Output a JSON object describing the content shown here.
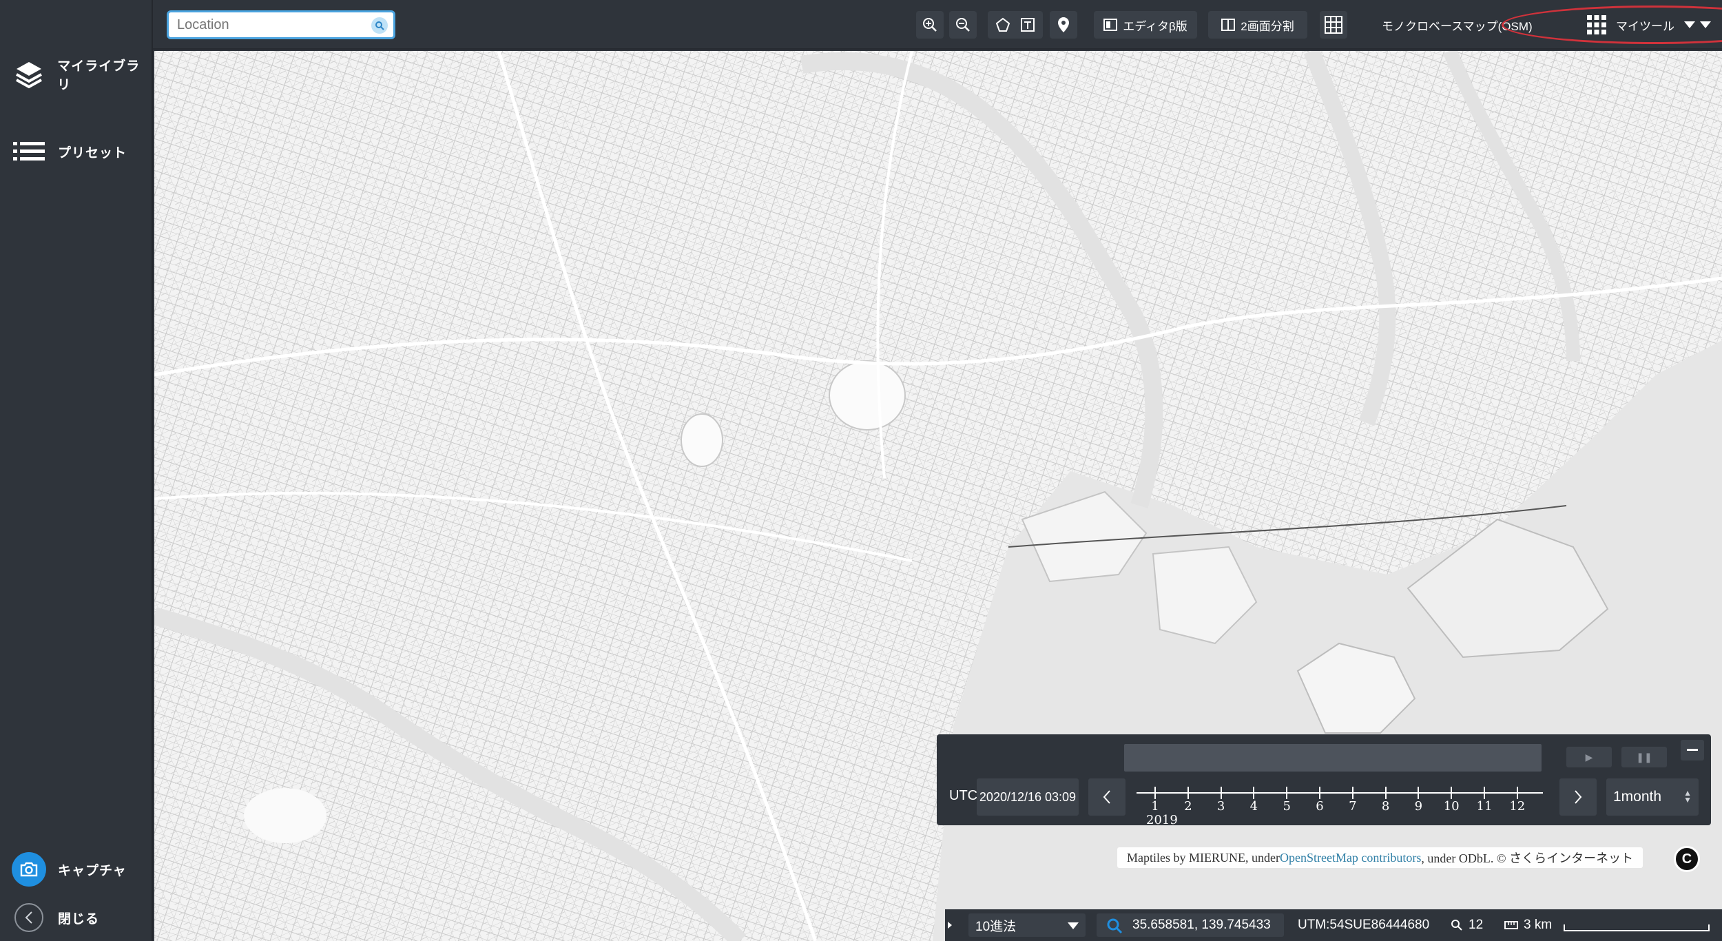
{
  "sidebar": {
    "items": [
      {
        "label": "マイライブラリ",
        "icon": "layers-icon"
      },
      {
        "label": "プリセット",
        "icon": "list-icon"
      }
    ],
    "capture_label": "キャプチャ",
    "close_label": "閉じる"
  },
  "toolbar": {
    "search_placeholder": "Location",
    "editor_label": "エディタβ版",
    "split_label": "2画面分割",
    "basemap_label": "モノクロベースマップ(OSM)",
    "mytools_label": "マイツール"
  },
  "timeline": {
    "timezone": "UTC",
    "current_datetime": "2020/12/16 03:09",
    "year": "2019",
    "months": [
      "1",
      "2",
      "3",
      "4",
      "5",
      "6",
      "7",
      "8",
      "9",
      "10",
      "11",
      "12"
    ],
    "step": "1month"
  },
  "attribution": {
    "prefix": "Maptiles by MIERUNE, under ",
    "link": "OpenStreetMap contributors",
    "suffix": ", under ODbL. © さくらインターネット",
    "badge": "C"
  },
  "status": {
    "radix": "10進法",
    "coordinates": "35.658581, 139.745433",
    "utm": "UTM:54SUE86444680",
    "zoom": "12",
    "scale": "3 km"
  },
  "colors": {
    "panel": "#2f343b",
    "accent": "#4aa3df",
    "highlight_ring": "#d0323b",
    "map_land": "#f2f2f2",
    "map_water": "#e6e6e6"
  }
}
